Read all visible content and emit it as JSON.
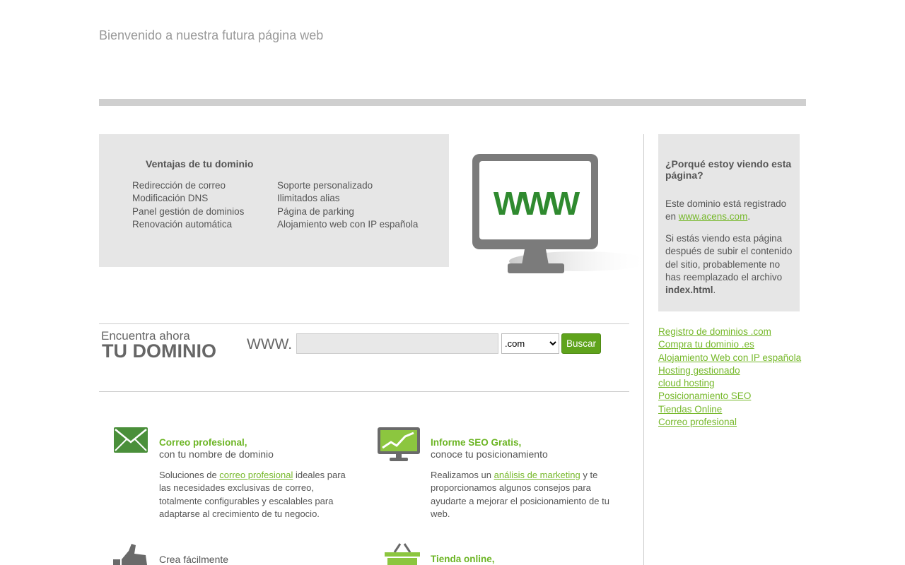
{
  "header": {
    "welcome": "Bienvenido a nuestra futura página web"
  },
  "advantages": {
    "title": "Ventajas de tu dominio",
    "col1": [
      "Redirección de correo",
      "Modificación DNS",
      "Panel gestión de dominios",
      "Renovación automática"
    ],
    "col2": [
      "Soporte personalizado",
      "Ilimitados alias",
      "Página de parking",
      "Alojamiento web con IP española"
    ]
  },
  "monitor": {
    "text": "WWW"
  },
  "why": {
    "title": "¿Porqué estoy viendo esta página?",
    "p1_pre": "Este dominio está registrado en ",
    "p1_link": "www.acens.com",
    "p1_post": ".",
    "p2_pre": "Si estás viendo esta página después de subir el contenido del sitio, probablemente no has reemplazado el archivo ",
    "p2_bold": "index.html",
    "p2_post": "."
  },
  "sidebar_links": [
    "Registro de dominios .com",
    "Compra tu dominio .es",
    "Alojamiento Web con IP española",
    "Hosting gestionado",
    "cloud hosting",
    "Posicionamiento SEO",
    "Tiendas Online",
    "Correo profesional"
  ],
  "search": {
    "line1": "Encuentra ahora",
    "line2": "TU DOMINIO",
    "prefix": "WWW.",
    "input_value": "",
    "tld_selected": ".com",
    "button": "Buscar"
  },
  "features": {
    "mail": {
      "title": "Correo profesional,",
      "subtitle": "con tu nombre de dominio",
      "desc_pre": "Soluciones de ",
      "desc_link": "correo profesional",
      "desc_post": " ideales para las necesidades exclusivas de correo, totalmente configurables y escalables para adaptarse al crecimiento de tu negocio."
    },
    "seo": {
      "title": "Informe SEO Gratis,",
      "subtitle": "conoce tu posicionamiento",
      "desc_pre": "Realizamos un ",
      "desc_link": "análisis de marketing",
      "desc_post": " y te proporcionamos algunos consejos para ayudarte a mejorar el posicionamiento de tu web."
    },
    "create": {
      "subtitle": "Crea fácilmente"
    },
    "shop": {
      "title": "Tienda online,"
    }
  },
  "colors": {
    "accent": "#76b82a",
    "button": "#5fa31c",
    "panel": "#e6e6e6"
  }
}
